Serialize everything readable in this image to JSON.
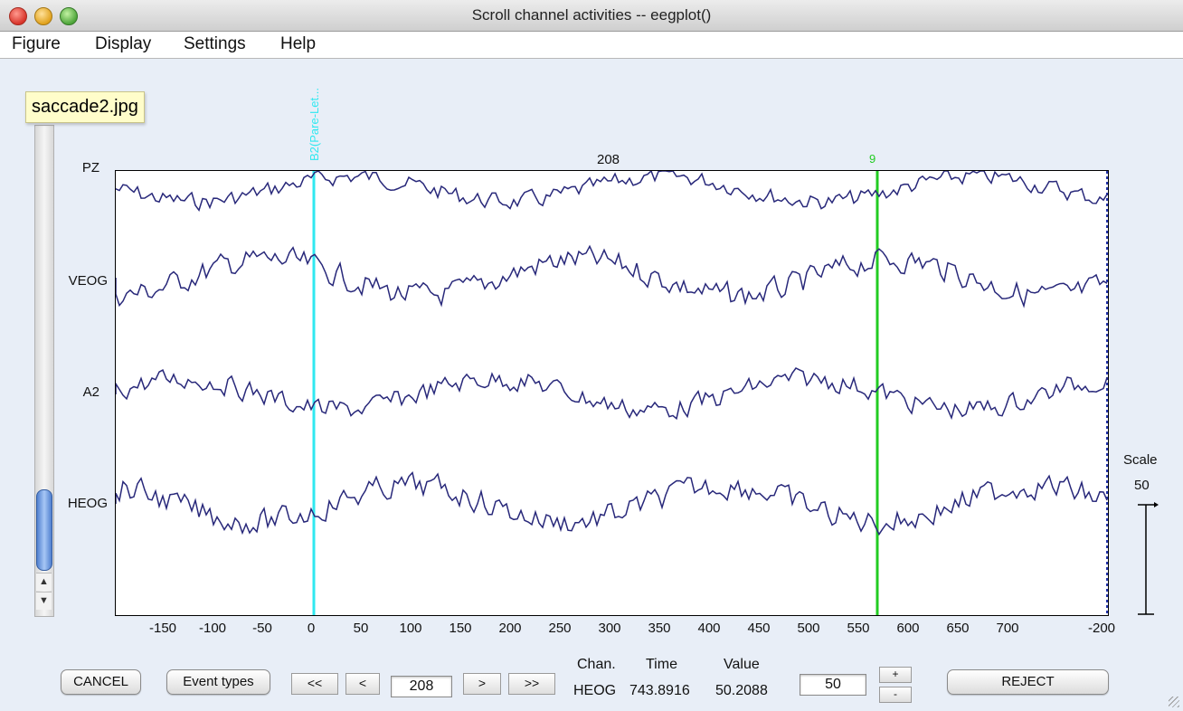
{
  "window": {
    "title": "Scroll channel activities -- eegplot()"
  },
  "menu": {
    "items": [
      "Figure",
      "Display",
      "Settings",
      "Help"
    ]
  },
  "tooltip": {
    "filename": "saccade2.jpg"
  },
  "plot": {
    "channels": [
      "PZ",
      "VEOG",
      "A2",
      "HEOG"
    ],
    "top_label": "208",
    "x_ticks": [
      "-150",
      "-100",
      "-50",
      "0",
      "50",
      "100",
      "150",
      "200",
      "250",
      "300",
      "350",
      "400",
      "450",
      "500",
      "550",
      "600",
      "650",
      "700",
      "-200"
    ],
    "events": [
      {
        "label": "B2(Pare-Let...",
        "color": "#2fe8f0"
      },
      {
        "label": "9",
        "color": "#22cc22"
      }
    ],
    "trace_color": "#28287a"
  },
  "scale": {
    "label": "Scale",
    "value": "50"
  },
  "controls": {
    "cancel": "CANCEL",
    "event_types": "Event types",
    "prev_fast": "<<",
    "prev": "<",
    "position": "208",
    "next": ">",
    "next_fast": ">>",
    "spacing": "50",
    "plus": "+",
    "minus": "-",
    "reject": "REJECT"
  },
  "readout": {
    "chan_header": "Chan.",
    "time_header": "Time",
    "value_header": "Value",
    "chan": "HEOG",
    "time": "743.8916",
    "value": "50.2088"
  },
  "scrollbar": {
    "up": "▲",
    "down": "▼"
  }
}
